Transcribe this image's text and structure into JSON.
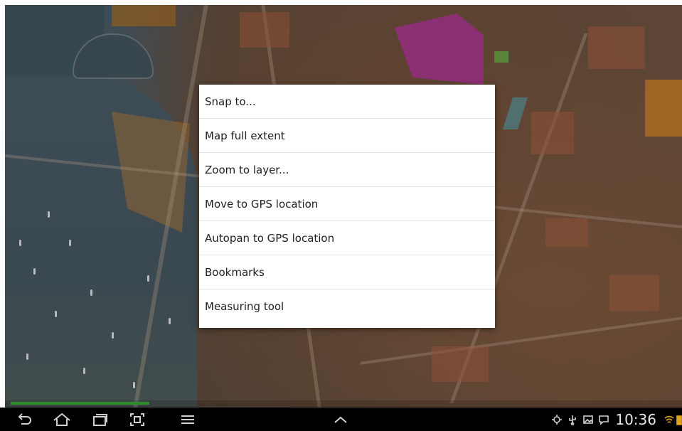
{
  "menu": {
    "items": [
      {
        "label": "Snap to..."
      },
      {
        "label": "Map full extent"
      },
      {
        "label": "Zoom to layer..."
      },
      {
        "label": "Move to GPS location"
      },
      {
        "label": "Autopan to GPS location"
      },
      {
        "label": "Bookmarks"
      },
      {
        "label": "Measuring tool"
      }
    ]
  },
  "status_bar": {
    "time": "10:36",
    "icons": [
      "gps-icon",
      "usb-icon",
      "image-icon",
      "chat-icon",
      "wifi-icon",
      "battery-icon"
    ]
  },
  "nav_bar": {
    "buttons": [
      "back-icon",
      "home-icon",
      "recent-apps-icon",
      "screenshot-icon",
      "menu-icon",
      "chevron-up-icon"
    ]
  },
  "colors": {
    "menu_bg": "#ffffff",
    "menu_text": "#222222",
    "nav_bg": "#000000",
    "progress": "#2e8b2e"
  }
}
